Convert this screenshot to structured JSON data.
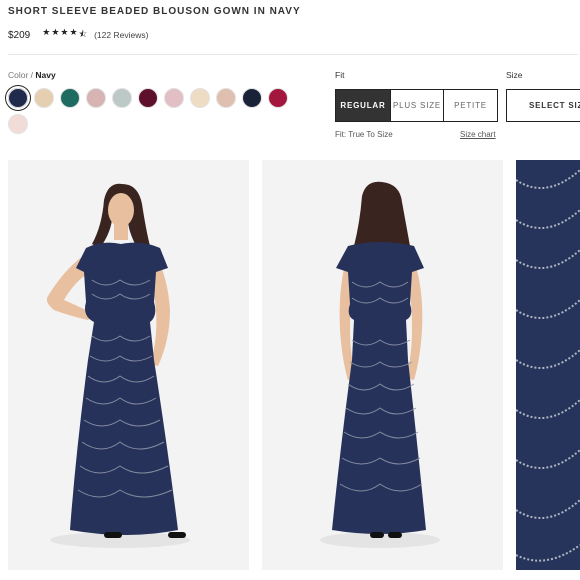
{
  "product": {
    "title": "SHORT SLEEVE BEADED BLOUSON GOWN IN NAVY",
    "price": "$209",
    "rating": 4.5,
    "reviews": "(122 Reviews)"
  },
  "color": {
    "label": "Color / ",
    "selected": "Navy",
    "swatches": [
      {
        "name": "navy",
        "hex": "#1f2a4d"
      },
      {
        "name": "champagne-beaded",
        "hex": "#e6cfb0"
      },
      {
        "name": "teal",
        "hex": "#1e6b62"
      },
      {
        "name": "blush-pink",
        "hex": "#d8b3b3"
      },
      {
        "name": "mint-grey",
        "hex": "#bcc9c6"
      },
      {
        "name": "burgundy",
        "hex": "#5e0f2b"
      },
      {
        "name": "rose",
        "hex": "#e2bfc4"
      },
      {
        "name": "nude",
        "hex": "#efdcc4"
      },
      {
        "name": "rose-gold",
        "hex": "#dfbfb0"
      },
      {
        "name": "midnight",
        "hex": "#1a2238"
      },
      {
        "name": "raspberry",
        "hex": "#a3173f"
      },
      {
        "name": "light-blush",
        "hex": "#f1dcd8"
      }
    ]
  },
  "fit": {
    "label": "Fit",
    "options": [
      "REGULAR",
      "PLUS SIZE",
      "PETITE"
    ],
    "selected": "REGULAR",
    "note": "Fit: True To Size",
    "size_chart": "Size chart"
  },
  "size": {
    "label": "Size",
    "select_label": "SELECT SIZE"
  },
  "colors": {
    "dress": "#27325a",
    "skin": "#e8bf9f",
    "hair": "#3a2420",
    "background": "#f3f3f3"
  }
}
